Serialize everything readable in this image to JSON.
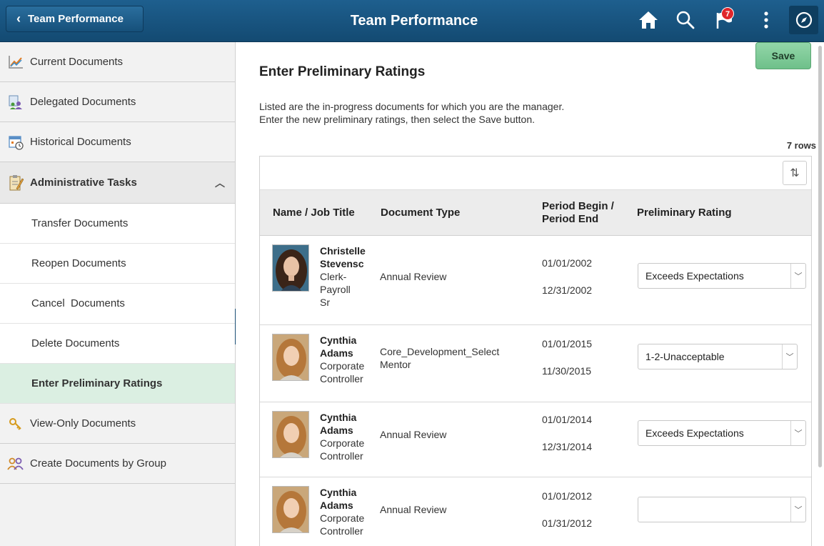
{
  "header": {
    "back_label": "Team Performance",
    "title": "Team Performance",
    "notification_count": "7",
    "icons": [
      "home-icon",
      "search-icon",
      "notification-flag-icon",
      "actions-menu-icon",
      "navbar-compass-icon"
    ]
  },
  "sidebar": {
    "items": [
      {
        "label": "Current Documents",
        "icon": "trend-chart-icon"
      },
      {
        "label": "Delegated Documents",
        "icon": "delegated-docs-icon"
      },
      {
        "label": "Historical Documents",
        "icon": "calendar-clock-icon"
      },
      {
        "label": "Administrative Tasks",
        "icon": "clipboard-pencil-icon"
      },
      {
        "label": "Transfer Documents"
      },
      {
        "label": "Reopen Documents"
      },
      {
        "label": "Cancel  Documents"
      },
      {
        "label": "Delete Documents"
      },
      {
        "label": "Enter Preliminary Ratings"
      },
      {
        "label": "View-Only Documents",
        "icon": "key-hand-icon"
      },
      {
        "label": "Create Documents by Group",
        "icon": "people-group-icon"
      }
    ]
  },
  "main": {
    "save_label": "Save",
    "title": "Enter Preliminary Ratings",
    "instructions_line1": "Listed are the in-progress documents for which you are the manager.",
    "instructions_line2": "Enter the new preliminary ratings, then select the Save button.",
    "row_count": "7 rows",
    "columns": [
      "Name / Job Title",
      "Document Type",
      "Period Begin /",
      "Period End",
      "Preliminary Rating"
    ],
    "rows": [
      {
        "name1": "Christelle",
        "name2": "Stevensc",
        "job1": "Clerk-",
        "job2": "Payroll",
        "job3": "Sr",
        "doc1": "Annual Review",
        "doc2": "",
        "begin": "01/01/2002",
        "end": "12/31/2002",
        "rating": "Exceeds Expectations"
      },
      {
        "name1": "Cynthia",
        "name2": "Adams",
        "job1": "Corporate",
        "job2": "Controller",
        "job3": "",
        "doc1": "Core_Development_Select",
        "doc2": "Mentor",
        "begin": "01/01/2015",
        "end": "11/30/2015",
        "rating": "1-2-Unacceptable"
      },
      {
        "name1": "Cynthia",
        "name2": "Adams",
        "job1": "Corporate",
        "job2": "Controller",
        "job3": "",
        "doc1": "Annual Review",
        "doc2": "",
        "begin": "01/01/2014",
        "end": "12/31/2014",
        "rating": "Exceeds Expectations"
      },
      {
        "name1": "Cynthia",
        "name2": "Adams",
        "job1": "Corporate",
        "job2": "Controller",
        "job3": "",
        "doc1": "Annual Review",
        "doc2": "",
        "begin": "01/01/2012",
        "end": "01/31/2012",
        "rating": ""
      }
    ]
  },
  "colors": {
    "header_bg": "#1a5783",
    "active_item_bg": "#dbefe2",
    "save_button_bg": "#7dca95",
    "badge_red": "#e0262b"
  }
}
